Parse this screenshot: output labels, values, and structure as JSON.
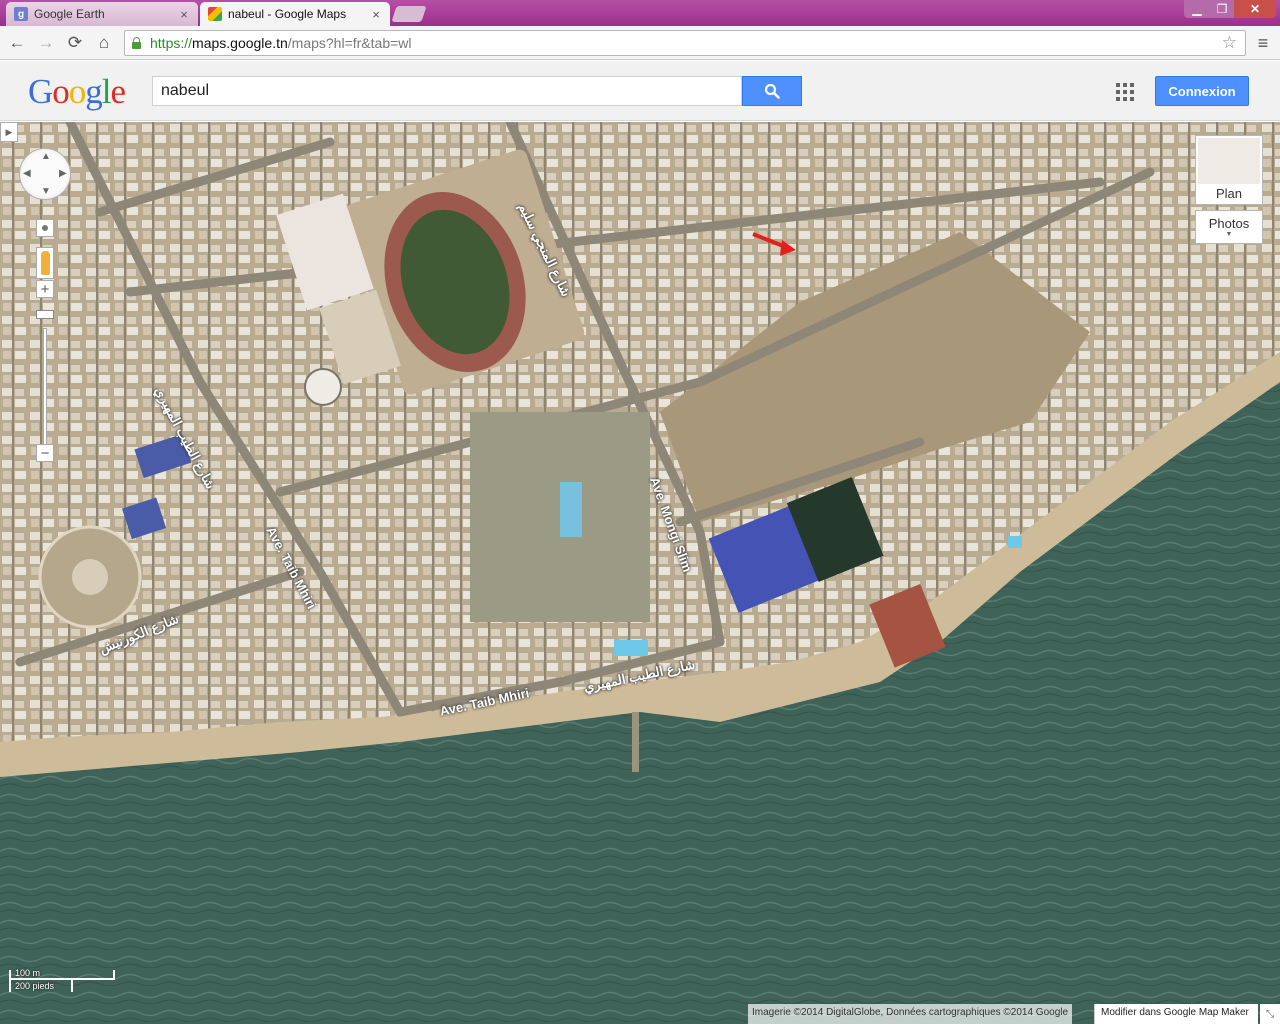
{
  "browser": {
    "tabs": [
      {
        "title": "Google Earth",
        "favicon": "google-earth-icon"
      },
      {
        "title": "nabeul - Google Maps",
        "favicon": "google-maps-icon"
      }
    ],
    "url": {
      "scheme": "https://",
      "host": "maps.google.tn",
      "path": "/maps?hl=fr&tab=wl"
    },
    "close_glyph": "×",
    "window_controls": {
      "minimize": "▁",
      "maximize": "❐",
      "close": "✕"
    },
    "nav_icons": {
      "back": "←",
      "forward": "→",
      "reload": "⟳",
      "home": "⌂",
      "star": "☆",
      "menu": "≡"
    }
  },
  "header": {
    "logo_letters": [
      {
        "ch": "G",
        "color": "#3b6ed8"
      },
      {
        "ch": "o",
        "color": "#d93025"
      },
      {
        "ch": "o",
        "color": "#f4b400"
      },
      {
        "ch": "g",
        "color": "#3b6ed8"
      },
      {
        "ch": "l",
        "color": "#23a04c"
      },
      {
        "ch": "e",
        "color": "#d93025"
      }
    ],
    "search_value": "nabeul",
    "signin_label": "Connexion"
  },
  "map": {
    "view": "satellite",
    "road_labels": [
      {
        "text": "شارع الطيب المهيري"
      },
      {
        "text": "Ave. Taib Mhiri"
      },
      {
        "text": "Ave. Mongi Slim"
      },
      {
        "text": "شارع المنجي سليم"
      },
      {
        "text": "شارع الكورنيش"
      },
      {
        "text": "Ave. Taib Mhiri"
      },
      {
        "text": "شارع الطيب المهيري"
      }
    ],
    "map_types": {
      "plan_label": "Plan",
      "photos_label": "Photos"
    },
    "scale": {
      "metric": "100 m",
      "imperial": "200 pieds"
    },
    "attribution": "Imagerie ©2014 DigitalGlobe, Données cartographiques ©2014 Google",
    "mapmaker_link": "Modifier dans Google Map Maker",
    "zoom_in": "+",
    "zoom_out": "−",
    "panel_toggle": "▶",
    "pan_arrows": {
      "up": "▲",
      "down": "▼",
      "left": "◀",
      "right": "▶"
    }
  },
  "colors": {
    "sea": "#3f6358",
    "beach": "#cdbb9a",
    "urban": "#b3a58d",
    "accent_blue": "#4d90fe"
  }
}
